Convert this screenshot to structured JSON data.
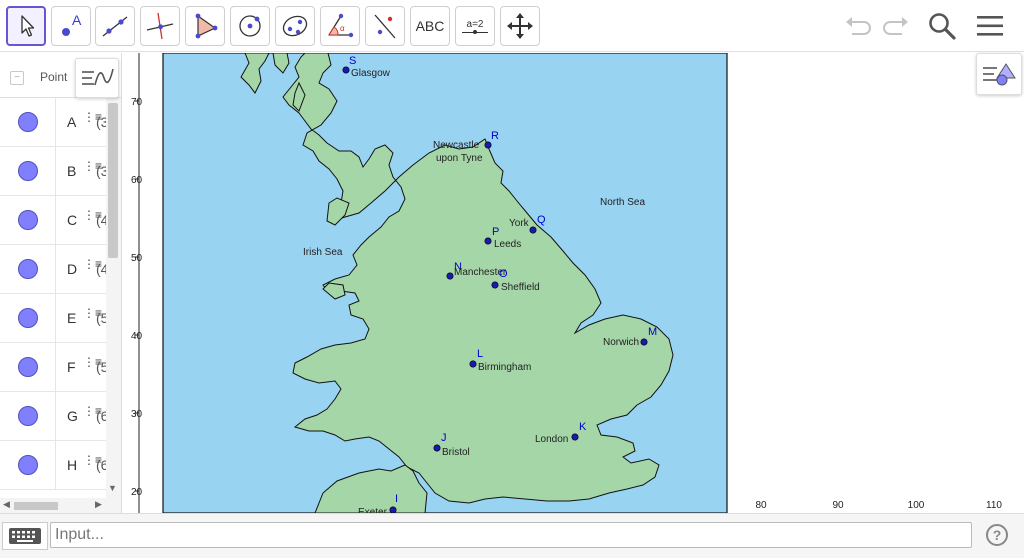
{
  "toolbar": {
    "tools": [
      {
        "name": "move-tool",
        "icon": "cursor-arrow-icon",
        "active": true
      },
      {
        "name": "point-tool",
        "icon": "point-a-icon"
      },
      {
        "name": "line-tool",
        "icon": "line-through-two-points-icon"
      },
      {
        "name": "perpendicular-tool",
        "icon": "perpendicular-line-icon"
      },
      {
        "name": "polygon-tool",
        "icon": "polygon-icon"
      },
      {
        "name": "circle-tool",
        "icon": "circle-center-point-icon"
      },
      {
        "name": "ellipse-tool",
        "icon": "ellipse-icon"
      },
      {
        "name": "angle-tool",
        "icon": "angle-icon"
      },
      {
        "name": "reflect-tool",
        "icon": "reflect-about-line-icon"
      },
      {
        "name": "text-tool",
        "icon": "text-icon",
        "label": "ABC"
      },
      {
        "name": "slider-tool",
        "icon": "slider-icon",
        "label": "a=2"
      },
      {
        "name": "move-graphics-tool",
        "icon": "move-graphics-view-icon"
      }
    ],
    "right": [
      {
        "name": "undo-button",
        "icon": "undo-icon"
      },
      {
        "name": "redo-button",
        "icon": "redo-icon"
      },
      {
        "name": "search-button",
        "icon": "search-icon"
      },
      {
        "name": "main-menu-button",
        "icon": "hamburger-menu-icon"
      }
    ]
  },
  "algebra": {
    "header_label": "Point",
    "collapse_symbol": "−",
    "rows": [
      {
        "name": "A",
        "value": "(3"
      },
      {
        "name": "B",
        "value": "(3"
      },
      {
        "name": "C",
        "value": "(4"
      },
      {
        "name": "D",
        "value": "(4"
      },
      {
        "name": "E",
        "value": "(5"
      },
      {
        "name": "F",
        "value": "(5"
      },
      {
        "name": "G",
        "value": "(6"
      },
      {
        "name": "H",
        "value": "(6"
      }
    ],
    "point_color": "#8080ff"
  },
  "graphics": {
    "y_ticks": [
      "70",
      "60",
      "50",
      "40",
      "30",
      "20"
    ],
    "x_ticks": [
      "80",
      "90",
      "100",
      "110"
    ],
    "sea_labels": [
      "North Sea",
      "Irish Sea"
    ],
    "cities": [
      {
        "point": "S",
        "city": "Glasgow"
      },
      {
        "point": "R",
        "city": "Newcastle",
        "city2": "upon Tyne"
      },
      {
        "point": "Q",
        "city": "York"
      },
      {
        "point": "P",
        "city": "Leeds"
      },
      {
        "point": "N",
        "city": "Manchester"
      },
      {
        "point": "O",
        "city": "Sheffield"
      },
      {
        "point": "M",
        "city": "Norwich"
      },
      {
        "point": "L",
        "city": "Birmingham"
      },
      {
        "point": "K",
        "city": "London"
      },
      {
        "point": "J",
        "city": "Bristol"
      },
      {
        "point": "I",
        "city": "Exeter"
      }
    ],
    "sea_color": "#99d3f2",
    "land_color": "#a5d6a7"
  },
  "inputbar": {
    "placeholder": "Input...",
    "help_label": "?"
  }
}
